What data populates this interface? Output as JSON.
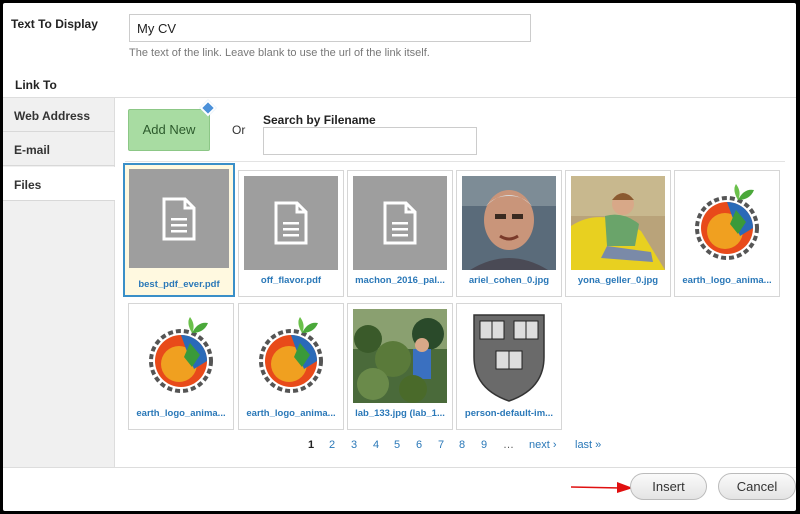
{
  "text_to_display": {
    "label": "Text To Display",
    "value": "My CV",
    "help": "The text of the link. Leave blank to use the url of the link itself."
  },
  "link_to": {
    "label": "Link To",
    "tabs": [
      {
        "label": "Web Address",
        "active": false
      },
      {
        "label": "E-mail",
        "active": false
      },
      {
        "label": "Files",
        "active": true
      }
    ]
  },
  "files_panel": {
    "add_new": "Add New",
    "or": "Or",
    "search_label": "Search by Filename",
    "search_value": "",
    "files": [
      {
        "name": "best_pdf_ever.pdf",
        "type": "doc",
        "selected": true
      },
      {
        "name": "off_flavor.pdf",
        "type": "doc",
        "selected": false
      },
      {
        "name": "machon_2016_pal...",
        "type": "doc",
        "selected": false
      },
      {
        "name": "ariel_cohen_0.jpg",
        "type": "photo-portrait",
        "selected": false
      },
      {
        "name": "yona_geller_0.jpg",
        "type": "photo-person",
        "selected": false
      },
      {
        "name": "earth_logo_anima...",
        "type": "earth-logo",
        "selected": false
      },
      {
        "name": "earth_logo_anima...",
        "type": "earth-logo",
        "selected": false
      },
      {
        "name": "earth_logo_anima...",
        "type": "earth-logo",
        "selected": false
      },
      {
        "name": "lab_133.jpg (lab_1...",
        "type": "photo-forest",
        "selected": false
      },
      {
        "name": "person-default-im...",
        "type": "shield",
        "selected": false
      }
    ],
    "pagination": {
      "pages": [
        "1",
        "2",
        "3",
        "4",
        "5",
        "6",
        "7",
        "8",
        "9"
      ],
      "current": "1",
      "ellipsis": "…",
      "next": "next ›",
      "last": "last »"
    }
  },
  "footer": {
    "insert": "Insert",
    "cancel": "Cancel"
  },
  "colors": {
    "accent_link": "#2a78b8",
    "add_new_bg": "#a8dca2",
    "selected_border": "#3a8fc8",
    "arrow": "#e01010"
  }
}
